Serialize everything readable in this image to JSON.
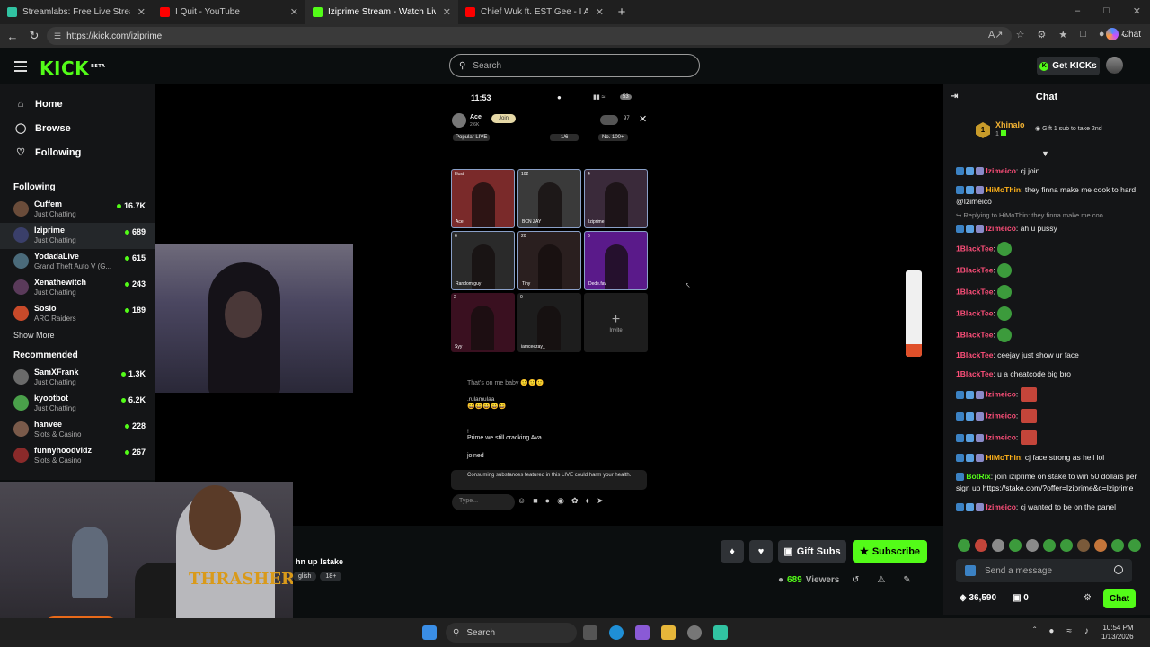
{
  "browser": {
    "tabs": [
      {
        "title": "Streamlabs: Free Live Streaming &",
        "active": false,
        "color": "#31c3a2"
      },
      {
        "title": "I Quit - YouTube",
        "active": false,
        "color": "#ff0000"
      },
      {
        "title": "Iziprime Stream - Watch Live on K",
        "active": true,
        "color": "#53fc18"
      },
      {
        "title": "Chief Wuk ft. EST Gee - I Ain't Lyin",
        "active": false,
        "color": "#ff0000"
      }
    ],
    "url": "https://kick.com/iziprime",
    "copilot_label": "Chat"
  },
  "header": {
    "logo": "KICK",
    "logo_sup": "BETA",
    "search_placeholder": "Search",
    "get_kicks_label": "Get KICKs"
  },
  "sidebar": {
    "nav": [
      {
        "label": "Home",
        "icon": "home-icon"
      },
      {
        "label": "Browse",
        "icon": "browse-icon"
      },
      {
        "label": "Following",
        "icon": "heart-icon"
      }
    ],
    "following_title": "Following",
    "following": [
      {
        "name": "Cuffem",
        "category": "Just Chatting",
        "viewers": "16.7K",
        "color": "#6a4c3a"
      },
      {
        "name": "Iziprime",
        "category": "Just Chatting",
        "viewers": "689",
        "color": "#3a3f6a",
        "selected": true
      },
      {
        "name": "YodadaLive",
        "category": "Grand Theft Auto V (G...",
        "viewers": "615",
        "color": "#4a6a7a"
      },
      {
        "name": "Xenathewitch",
        "category": "Just Chatting",
        "viewers": "243",
        "color": "#5a3a5a"
      },
      {
        "name": "Sosio",
        "category": "ARC Raiders",
        "viewers": "189",
        "color": "#c84a2a"
      }
    ],
    "show_more": "Show More",
    "recommended_title": "Recommended",
    "recommended": [
      {
        "name": "SamXFrank",
        "category": "Just Chatting",
        "viewers": "1.3K",
        "color": "#6a6a6a"
      },
      {
        "name": "kyootbot",
        "category": "Just Chatting",
        "viewers": "6.2K",
        "color": "#4aa04a"
      },
      {
        "name": "hanvee",
        "category": "Slots & Casino",
        "viewers": "228",
        "color": "#7a5a4a"
      },
      {
        "name": "funnyhoodvidz",
        "category": "Slots & Casino",
        "viewers": "267",
        "color": "#8a2a2a"
      }
    ]
  },
  "phone": {
    "time": "11:53",
    "battery": "53",
    "host_name": "Ace",
    "host_sub": "2.6K",
    "join_label": "Join",
    "top_count": "97",
    "popular_label": "Popular LIVE",
    "fraction": "1/6",
    "rank_label": "No. 100+",
    "grid": [
      {
        "label": "Ace",
        "tag": "Host",
        "color": "#7a2a2a"
      },
      {
        "label": "BCN ZAY",
        "tag": "102",
        "color": "#3a3a3a"
      },
      {
        "label": "Iziprime",
        "tag": "4",
        "color": "#3a2a3a"
      },
      {
        "label": "Random guy",
        "tag": "6",
        "color": "#2a2a2a"
      },
      {
        "label": "Tiny",
        "tag": "20",
        "color": "#2a1f1f"
      },
      {
        "label": "Dede.fav",
        "tag": "6",
        "color": "#5a1a8a"
      },
      {
        "label": "Syy",
        "tag": "2",
        "color": "#3a1020"
      },
      {
        "label": "iamceezay_",
        "tag": "0",
        "color": "#1d1d1d"
      }
    ],
    "invite_label": "Invite",
    "comments": [
      {
        "user": "",
        "text": "That's on me baby 🙂🙂🙂"
      },
      {
        "user": ".rulamulaa",
        "text": "😀😀😀😀😀"
      },
      {
        "user": "!",
        "text": "Prime we still cracking Ava"
      },
      {
        "user": "",
        "text": "joined"
      }
    ],
    "warning": "Consuming substances featured in this LIVE could harm your health.",
    "type_placeholder": "Type..."
  },
  "stream": {
    "title_fragment": "hn up !stake",
    "tags": [
      "glish",
      "18+"
    ],
    "gift_label": "Gift Subs",
    "subscribe_label": "Subscribe",
    "viewers_count": "689",
    "viewers_label": "Viewers"
  },
  "chat": {
    "title": "Chat",
    "pinned_user": "Xhinalo",
    "pinned_count": "1",
    "pinned_note": "Gift 1 sub to take 2nd",
    "messages": [
      {
        "user": "Izimeico",
        "color": "#ff4f7a",
        "text": "cj join"
      },
      {
        "user": "HiMoThin",
        "color": "#ffb21a",
        "text": "they finna make me cook to hard @Izimeico"
      },
      {
        "reply": "Replying to HiMoThin: they finna make me coo..."
      },
      {
        "user": "Izimeico",
        "color": "#ff4f7a",
        "text": "ah u pussy"
      },
      {
        "user": "1BlackTee",
        "color": "#ff4f7a",
        "emote": true
      },
      {
        "user": "1BlackTee",
        "color": "#ff4f7a",
        "emote": true
      },
      {
        "user": "1BlackTee",
        "color": "#ff4f7a",
        "emote": true
      },
      {
        "user": "1BlackTee",
        "color": "#ff4f7a",
        "emote": true
      },
      {
        "user": "1BlackTee",
        "color": "#ff4f7a",
        "emote": true
      },
      {
        "user": "1BlackTee",
        "color": "#ff4f7a",
        "text": "ceejay just show ur face"
      },
      {
        "user": "1BlackTee",
        "color": "#ff4f7a",
        "text": "u a cheatcode big bro"
      },
      {
        "user": "Izimeico",
        "color": "#ff4f7a",
        "face": true
      },
      {
        "user": "Izimeico",
        "color": "#ff4f7a",
        "face": true
      },
      {
        "user": "Izimeico",
        "color": "#ff4f7a",
        "face": true
      },
      {
        "user": "HiMoThin",
        "color": "#ffb21a",
        "text": "cj face strong as hell lol"
      },
      {
        "user": "BotRix",
        "color": "#53fc18",
        "text": "join iziprime on stake to win 50 dollars per sign up ",
        "link": "https://stake.com/?offer=Iziprime&c=Iziprime"
      },
      {
        "user": "Izimeico",
        "color": "#ff4f7a",
        "text": "cj wanted to be on the panel"
      }
    ],
    "send_placeholder": "Send a message",
    "points": "36,590",
    "zero_count": "0",
    "chat_button": "Chat"
  },
  "taskbar": {
    "search": "Search",
    "time": "10:54 PM",
    "date": "1/13/2026"
  }
}
